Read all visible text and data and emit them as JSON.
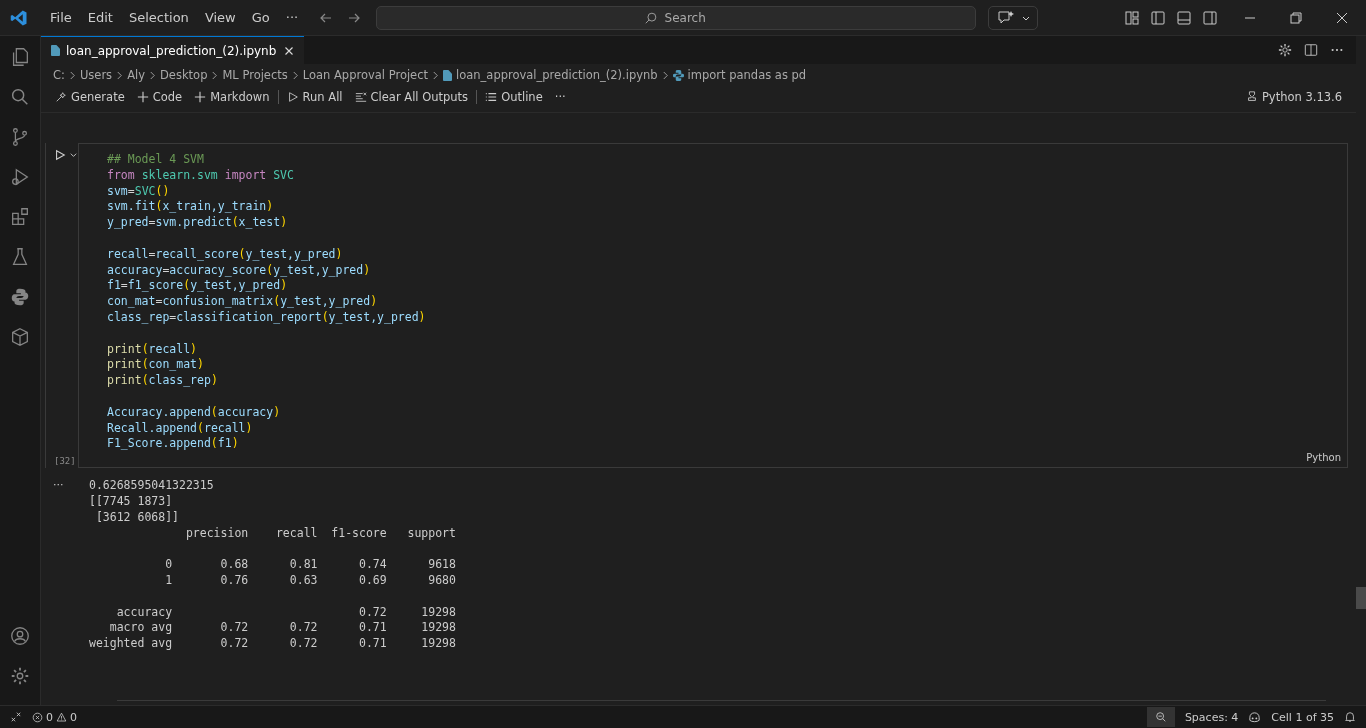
{
  "menu": [
    "File",
    "Edit",
    "Selection",
    "View",
    "Go",
    "···"
  ],
  "search": {
    "placeholder": "Search"
  },
  "tab": {
    "label": "loan_approval_prediction_(2).ipynb",
    "selected": true
  },
  "breadcrumb": [
    "C:",
    "Users",
    "Aly",
    "Desktop",
    "ML Projects",
    "Loan Approval Project",
    "loan_approval_prediction_(2).ipynb",
    "import pandas as pd"
  ],
  "toolbar": [
    {
      "kind": "generate",
      "label": "Generate"
    },
    {
      "kind": "add",
      "label": "Code"
    },
    {
      "kind": "add",
      "label": "Markdown"
    },
    {
      "kind": "run",
      "label": "Run All"
    },
    {
      "kind": "clear",
      "label": "Clear All Outputs"
    },
    {
      "kind": "outline",
      "label": "Outline"
    },
    {
      "kind": "more",
      "label": "···"
    }
  ],
  "kernel": "Python 3.13.6",
  "cell": {
    "execution_count": "[32]",
    "language": "Python",
    "lines": [
      {
        "kind": "code",
        "tokens": [
          {
            "kind": "comment",
            "text": "## Model 4 SVM"
          }
        ]
      },
      {
        "kind": "code",
        "tokens": [
          {
            "kind": "keyword",
            "text": "from "
          },
          {
            "kind": "class",
            "text": "sklearn.svm "
          },
          {
            "kind": "keyword",
            "text": "import "
          },
          {
            "kind": "class",
            "text": "SVC"
          }
        ]
      },
      {
        "kind": "code",
        "tokens": [
          {
            "kind": "var",
            "text": "svm"
          },
          {
            "kind": "plain",
            "text": "="
          },
          {
            "kind": "class",
            "text": "SVC"
          },
          {
            "kind": "paren",
            "text": "()"
          }
        ]
      },
      {
        "kind": "code",
        "tokens": [
          {
            "kind": "var",
            "text": "svm.fit"
          },
          {
            "kind": "paren",
            "text": "("
          },
          {
            "kind": "var",
            "text": "x_train,y_train"
          },
          {
            "kind": "paren",
            "text": ")"
          }
        ]
      },
      {
        "kind": "code",
        "tokens": [
          {
            "kind": "var",
            "text": "y_pred"
          },
          {
            "kind": "plain",
            "text": "="
          },
          {
            "kind": "var",
            "text": "svm.predict"
          },
          {
            "kind": "paren",
            "text": "("
          },
          {
            "kind": "var",
            "text": "x_test"
          },
          {
            "kind": "paren",
            "text": ")"
          }
        ]
      },
      {
        "kind": "blank"
      },
      {
        "kind": "code",
        "tokens": [
          {
            "kind": "var",
            "text": "recall"
          },
          {
            "kind": "plain",
            "text": "="
          },
          {
            "kind": "var",
            "text": "recall_score"
          },
          {
            "kind": "paren",
            "text": "("
          },
          {
            "kind": "var",
            "text": "y_test,y_pred"
          },
          {
            "kind": "paren",
            "text": ")"
          }
        ]
      },
      {
        "kind": "code",
        "tokens": [
          {
            "kind": "var",
            "text": "accuracy"
          },
          {
            "kind": "plain",
            "text": "="
          },
          {
            "kind": "var",
            "text": "accuracy_score"
          },
          {
            "kind": "paren",
            "text": "("
          },
          {
            "kind": "var",
            "text": "y_test,y_pred"
          },
          {
            "kind": "paren",
            "text": ")"
          }
        ]
      },
      {
        "kind": "code",
        "tokens": [
          {
            "kind": "var",
            "text": "f1"
          },
          {
            "kind": "plain",
            "text": "="
          },
          {
            "kind": "var",
            "text": "f1_score"
          },
          {
            "kind": "paren",
            "text": "("
          },
          {
            "kind": "var",
            "text": "y_test,y_pred"
          },
          {
            "kind": "paren",
            "text": ")"
          }
        ]
      },
      {
        "kind": "code",
        "tokens": [
          {
            "kind": "var",
            "text": "con_mat"
          },
          {
            "kind": "plain",
            "text": "="
          },
          {
            "kind": "var",
            "text": "confusion_matrix"
          },
          {
            "kind": "paren",
            "text": "("
          },
          {
            "kind": "var",
            "text": "y_test,y_pred"
          },
          {
            "kind": "paren",
            "text": ")"
          }
        ]
      },
      {
        "kind": "code",
        "tokens": [
          {
            "kind": "var",
            "text": "class_rep"
          },
          {
            "kind": "plain",
            "text": "="
          },
          {
            "kind": "var",
            "text": "classification_report"
          },
          {
            "kind": "paren",
            "text": "("
          },
          {
            "kind": "var",
            "text": "y_test,y_pred"
          },
          {
            "kind": "paren",
            "text": ")"
          }
        ]
      },
      {
        "kind": "blank"
      },
      {
        "kind": "code",
        "tokens": [
          {
            "kind": "func",
            "text": "print"
          },
          {
            "kind": "paren",
            "text": "("
          },
          {
            "kind": "var",
            "text": "recall"
          },
          {
            "kind": "paren",
            "text": ")"
          }
        ]
      },
      {
        "kind": "code",
        "tokens": [
          {
            "kind": "func",
            "text": "print"
          },
          {
            "kind": "paren",
            "text": "("
          },
          {
            "kind": "var",
            "text": "con_mat"
          },
          {
            "kind": "paren",
            "text": ")"
          }
        ]
      },
      {
        "kind": "code",
        "tokens": [
          {
            "kind": "func",
            "text": "print"
          },
          {
            "kind": "paren",
            "text": "("
          },
          {
            "kind": "var",
            "text": "class_rep"
          },
          {
            "kind": "paren",
            "text": ")"
          }
        ]
      },
      {
        "kind": "blank"
      },
      {
        "kind": "code",
        "tokens": [
          {
            "kind": "var",
            "text": "Accuracy.append"
          },
          {
            "kind": "paren",
            "text": "("
          },
          {
            "kind": "var",
            "text": "accuracy"
          },
          {
            "kind": "paren",
            "text": ")"
          }
        ]
      },
      {
        "kind": "code",
        "tokens": [
          {
            "kind": "var",
            "text": "Recall.append"
          },
          {
            "kind": "paren",
            "text": "("
          },
          {
            "kind": "var",
            "text": "recall"
          },
          {
            "kind": "paren",
            "text": ")"
          }
        ]
      },
      {
        "kind": "code",
        "tokens": [
          {
            "kind": "var",
            "text": "F1_Score.append"
          },
          {
            "kind": "paren",
            "text": "("
          },
          {
            "kind": "var",
            "text": "f1"
          },
          {
            "kind": "paren",
            "text": ")"
          }
        ]
      }
    ]
  },
  "output": {
    "marker": "···",
    "lines": [
      {
        "kind": "text",
        "text": "0.6268595041322315"
      },
      {
        "kind": "text",
        "text": "[[7745 1873]"
      },
      {
        "kind": "text",
        "text": " [3612 6068]]"
      },
      {
        "kind": "text",
        "text": "              precision    recall  f1-score   support"
      },
      {
        "kind": "blank"
      },
      {
        "kind": "text",
        "text": "           0       0.68      0.81      0.74      9618"
      },
      {
        "kind": "text",
        "text": "           1       0.76      0.63      0.69      9680"
      },
      {
        "kind": "blank"
      },
      {
        "kind": "text",
        "text": "    accuracy                           0.72     19298"
      },
      {
        "kind": "text",
        "text": "   macro avg       0.72      0.72      0.71     19298"
      },
      {
        "kind": "text",
        "text": "weighted avg       0.72      0.72      0.71     19298"
      }
    ]
  },
  "status_bar": {
    "errors": "0",
    "warnings": "0",
    "spaces": "Spaces: 4",
    "cell": "Cell 1 of 35"
  }
}
